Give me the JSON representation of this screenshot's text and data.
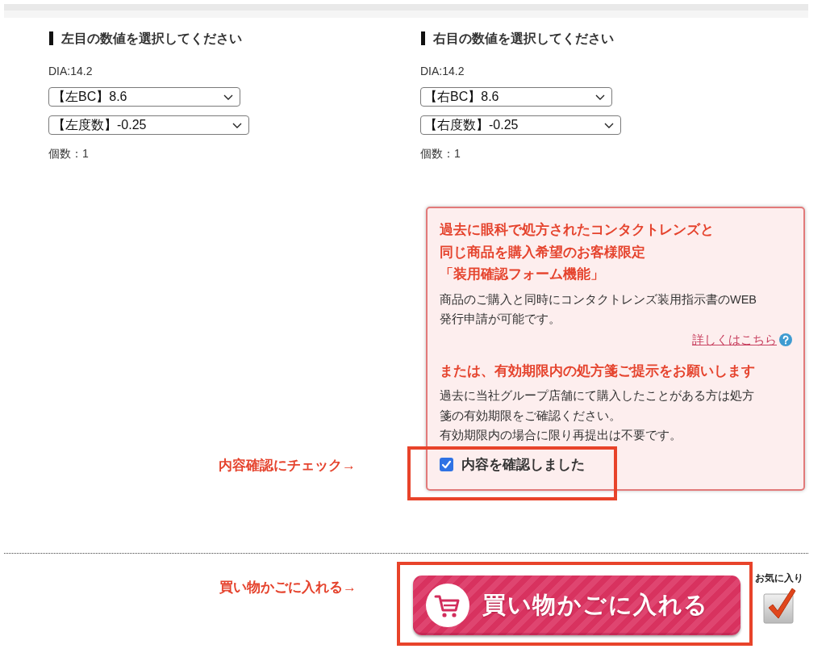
{
  "eye_panels": [
    {
      "heading": "左目の数値を選択してください",
      "dia": "DIA:14.2",
      "selects": [
        "【左BC】8.6",
        "【左度数】-0.25"
      ],
      "quantity": "個数：1"
    },
    {
      "heading": "右目の数値を選択してください",
      "dia": "DIA:14.2",
      "selects": [
        "【右BC】8.6",
        "【右度数】-0.25"
      ],
      "quantity": "個数：1"
    }
  ],
  "notice": {
    "blocks": [
      {
        "kind": "heading",
        "lines": [
          "過去に眼科で処方されたコンタクトレンズと",
          "同じ商品を購入希望のお客様限定",
          "「装用確認フォーム機能」"
        ]
      },
      {
        "kind": "text",
        "lines": [
          "商品のご購入と同時にコンタクトレンズ装用指示書のWEB",
          "発行申請が可能です。"
        ]
      },
      {
        "kind": "link",
        "label": "詳しくはこちら"
      },
      {
        "kind": "heading",
        "lines": [
          "または、有効期限内の処方箋ご提示をお願いします"
        ]
      },
      {
        "kind": "text",
        "lines": [
          "過去に当社グループ店舗にて購入したことがある方は処方",
          "箋の有効期限をご確認ください。",
          "有効期限内の場合に限り再提出は不要です。"
        ]
      }
    ],
    "confirm": {
      "label": "内容を確認しました",
      "checked": true,
      "callout": "内容確認にチェック→"
    }
  },
  "cart": {
    "callout": "買い物かごに入れる→",
    "button": "買い物かごに入れる"
  },
  "favorite": {
    "label": "お気に入り"
  }
}
